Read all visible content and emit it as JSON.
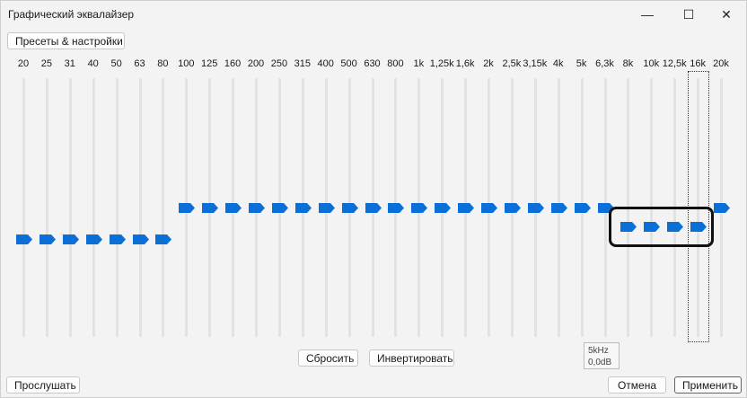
{
  "window": {
    "title": "Графический эквалайзер"
  },
  "titlebar_buttons": {
    "minimize": "—",
    "maximize": "☐",
    "close": "✕"
  },
  "presets_button": "Пресеты & настройки",
  "bands": [
    {
      "label": "20",
      "gain": -1
    },
    {
      "label": "25",
      "gain": -1
    },
    {
      "label": "31",
      "gain": -1
    },
    {
      "label": "40",
      "gain": -1
    },
    {
      "label": "50",
      "gain": -1
    },
    {
      "label": "63",
      "gain": -1
    },
    {
      "label": "80",
      "gain": -1
    },
    {
      "label": "100",
      "gain": 0
    },
    {
      "label": "125",
      "gain": 0
    },
    {
      "label": "160",
      "gain": 0
    },
    {
      "label": "200",
      "gain": 0
    },
    {
      "label": "250",
      "gain": 0
    },
    {
      "label": "315",
      "gain": 0
    },
    {
      "label": "400",
      "gain": 0
    },
    {
      "label": "500",
      "gain": 0
    },
    {
      "label": "630",
      "gain": 0
    },
    {
      "label": "800",
      "gain": 0
    },
    {
      "label": "1k",
      "gain": 0
    },
    {
      "label": "1,25k",
      "gain": 0
    },
    {
      "label": "1,6k",
      "gain": 0
    },
    {
      "label": "2k",
      "gain": 0
    },
    {
      "label": "2,5k",
      "gain": 0
    },
    {
      "label": "3,15k",
      "gain": 0
    },
    {
      "label": "4k",
      "gain": 0
    },
    {
      "label": "5k",
      "gain": 0
    },
    {
      "label": "6,3k",
      "gain": 0
    },
    {
      "label": "8k",
      "gain": -0.6
    },
    {
      "label": "10k",
      "gain": -0.6
    },
    {
      "label": "12,5k",
      "gain": -0.6
    },
    {
      "label": "16k",
      "gain": -0.6
    },
    {
      "label": "20k",
      "gain": 0
    }
  ],
  "tooltip": {
    "freq": "5kHz",
    "gain": "0,0dB"
  },
  "buttons": {
    "reset": "Сбросить",
    "invert": "Инвертировать",
    "listen": "Прослушать",
    "cancel": "Отмена",
    "apply": "Применить"
  },
  "colors": {
    "thumb": "#0a6fd6",
    "track": "#e2e2e2",
    "accent_border": "#2b6fbf"
  }
}
